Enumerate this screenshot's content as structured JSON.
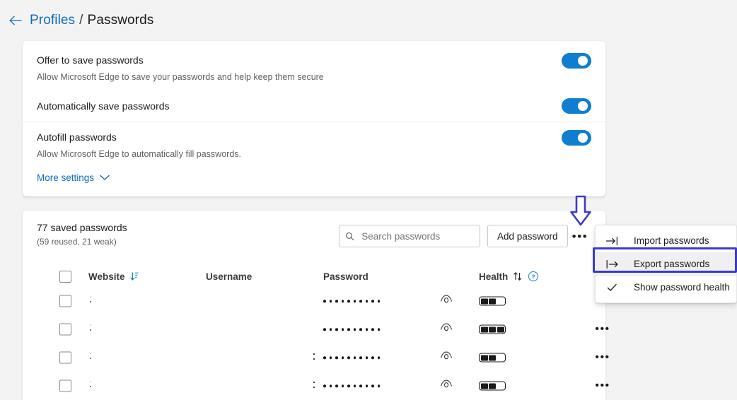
{
  "breadcrumb": {
    "back_icon": "arrow-left-icon",
    "parent": "Profiles",
    "separator": "/",
    "current": "Passwords"
  },
  "settings_card": {
    "rows": [
      {
        "title": "Offer to save passwords",
        "desc": "Allow Microsoft Edge to save your passwords and help keep them secure",
        "toggle_on": true
      },
      {
        "title": "Automatically save passwords",
        "desc": "",
        "toggle_on": true
      },
      {
        "title": "Autofill passwords",
        "desc": "Allow Microsoft Edge to automatically fill passwords.",
        "toggle_on": true
      }
    ],
    "more_settings_label": "More settings",
    "more_settings_icon": "chevron-down-icon"
  },
  "list_card": {
    "saved_count_label": "77 saved passwords",
    "saved_sub_label": "(59 reused, 21 weak)",
    "search": {
      "icon": "search-icon",
      "placeholder": "Search passwords",
      "value": ""
    },
    "add_password_label": "Add password",
    "overflow_icon": "ellipsis-horizontal-icon",
    "overflow_label": "•••",
    "table": {
      "columns": [
        "Website",
        "Username",
        "Password",
        "Health"
      ],
      "website_sort_icon": "sort-descending-icon",
      "health_sort_icon": "sort-updown-icon",
      "health_help_icon": "help-circle-icon",
      "select_all_checkbox": false,
      "rows": [
        {
          "website": "",
          "username": "",
          "password_mask": "••••••••••",
          "reveal_icon": "eye-icon",
          "health_segments": 3,
          "health_filled": 2,
          "menu_icon": "ellipsis-horizontal-icon",
          "menu_label": "•••",
          "selected": false
        },
        {
          "website": "",
          "username": "",
          "password_mask": "••••••••••",
          "reveal_icon": "eye-icon",
          "health_segments": 3,
          "health_filled": 3,
          "menu_icon": "ellipsis-horizontal-icon",
          "menu_label": "•••",
          "selected": false
        },
        {
          "website": "",
          "username": "",
          "password_mask": "••••••••••",
          "reveal_icon": "eye-icon",
          "health_segments": 3,
          "health_filled": 2,
          "menu_icon": "ellipsis-horizontal-icon",
          "menu_label": "•••",
          "selected": false
        },
        {
          "website": "",
          "username": "",
          "password_mask": "••••••••••",
          "reveal_icon": "eye-icon",
          "health_segments": 3,
          "health_filled": 2,
          "menu_icon": "ellipsis-horizontal-icon",
          "menu_label": "•••",
          "selected": false
        }
      ]
    }
  },
  "context_menu": {
    "items": [
      {
        "label": "Import passwords",
        "icon": "import-arrow-icon",
        "highlighted": false,
        "checked": false
      },
      {
        "label": "Export passwords",
        "icon": "export-arrow-icon",
        "highlighted": true,
        "checked": false
      },
      {
        "label": "Show password health",
        "icon": "checkmark-icon",
        "highlighted": false,
        "checked": true
      }
    ]
  },
  "annotation": {
    "arrow_icon": "down-arrow-annotation",
    "target": "Export passwords"
  },
  "colors": {
    "accent_blue": "#0f6cbd",
    "toggle_on": "#0f7ed1",
    "page_background": "#f3f3f3",
    "card_background": "#ffffff",
    "annotation": "#3b3bc6",
    "menu_highlight": "#f0f0f0",
    "text_primary": "#1b1b1b",
    "text_secondary": "#616161"
  }
}
